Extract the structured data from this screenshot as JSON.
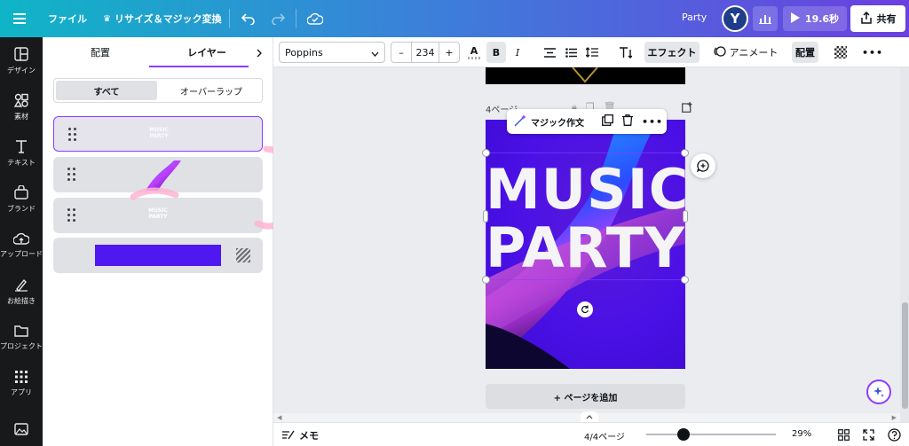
{
  "topbar": {
    "file_label": "ファイル",
    "resize_label": "リサイズ＆マジック変換",
    "project_name": "Party",
    "avatar_letter": "Y",
    "timer_label": "19.6秒",
    "share_label": "共有"
  },
  "rail": {
    "items": [
      {
        "label": "デザイン",
        "icon": "layout-icon"
      },
      {
        "label": "素材",
        "icon": "shapes-icon"
      },
      {
        "label": "テキスト",
        "icon": "text-icon"
      },
      {
        "label": "ブランド",
        "icon": "brand-icon"
      },
      {
        "label": "アップロード",
        "icon": "upload-icon"
      },
      {
        "label": "お絵描き",
        "icon": "draw-icon"
      },
      {
        "label": "プロジェクト",
        "icon": "folder-icon"
      },
      {
        "label": "アプリ",
        "icon": "apps-icon"
      }
    ]
  },
  "panel": {
    "tab_position": "配置",
    "tab_layers": "レイヤー",
    "seg_all": "すべて",
    "seg_overlap": "オーバーラップ",
    "layer_text_line1": "MUSIC",
    "layer_text_line2": "PARTY"
  },
  "toolbar": {
    "font_name": "Poppins",
    "font_size": "234",
    "minus_label": "–",
    "plus_label": "+",
    "text_color_label": "A",
    "bold_label": "B",
    "italic_label": "I",
    "effects_label": "エフェクト",
    "animate_label": "アニメート",
    "position_label": "配置"
  },
  "canvas": {
    "page_label": "4ページ -",
    "magic_write_label": "マジック作文",
    "poster_line1": "MUSIC",
    "poster_line2": "PARTY",
    "add_page_label": "+ ページを追加"
  },
  "bottombar": {
    "notes_label": "メモ",
    "page_indicator": "4/4ページ",
    "zoom_label": "29%",
    "zoom_fraction": 0.29
  },
  "colors": {
    "accent": "#8b3dff",
    "poster_bg": "#4a10e6",
    "layer_rect": "#5018f0"
  }
}
